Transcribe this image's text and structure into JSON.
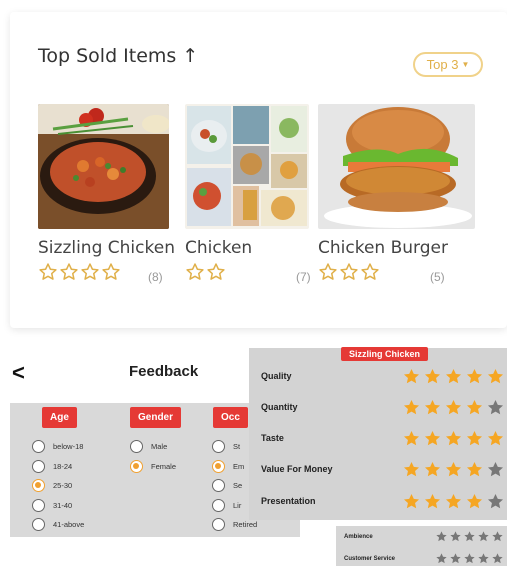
{
  "top_sold": {
    "title": "Top Sold Items ↑",
    "dropdown_label": "Top 3",
    "items": [
      {
        "name": "Sizzling Chicken",
        "stars": 4,
        "count": "(8)"
      },
      {
        "name": "Chicken",
        "stars": 2,
        "count": "(7)"
      },
      {
        "name": "Chicken Burger",
        "stars": 3,
        "count": "(5)"
      }
    ]
  },
  "feedback": {
    "back_glyph": "<",
    "title": "Feedback",
    "columns": [
      {
        "heading": "Age",
        "options": [
          "below-18",
          "18-24",
          "25-30",
          "31-40",
          "41-above"
        ],
        "selected": 2
      },
      {
        "heading": "Gender",
        "options": [
          "Male",
          "Female"
        ],
        "selected": 1
      },
      {
        "heading": "Occ",
        "options": [
          "St",
          "Em",
          "Se",
          "Lir",
          "Retired"
        ],
        "selected": 1
      }
    ]
  },
  "ratings": {
    "tag": "Sizzling Chicken",
    "rows": [
      {
        "label": "Quality",
        "filled": 5
      },
      {
        "label": "Quantity",
        "filled": 4
      },
      {
        "label": "Taste",
        "filled": 5
      },
      {
        "label": "Value For Money",
        "filled": 4
      },
      {
        "label": "Presentation",
        "filled": 4
      }
    ],
    "star_color": "#f5a623",
    "empty_star_color": "#777777"
  },
  "small_ratings": {
    "rows": [
      {
        "label": "Ambience",
        "filled": 0
      },
      {
        "label": "Customer Service",
        "filled": 0
      }
    ]
  },
  "colors": {
    "accent_red": "#e53935",
    "gold": "#e0b04a",
    "radio_selected": "#f0a030"
  }
}
